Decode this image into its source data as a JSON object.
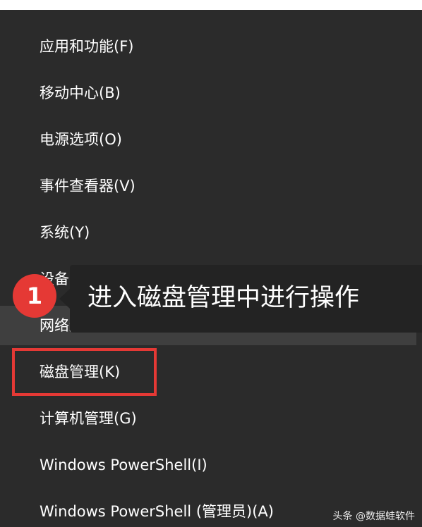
{
  "menu": {
    "items": [
      {
        "label": "应用和功能(F)"
      },
      {
        "label": "移动中心(B)"
      },
      {
        "label": "电源选项(O)"
      },
      {
        "label": "事件查看器(V)"
      },
      {
        "label": "系统(Y)"
      },
      {
        "label": "设备管理器(M)"
      },
      {
        "label": "网络连接(W)"
      },
      {
        "label": "磁盘管理(K)"
      },
      {
        "label": "计算机管理(G)"
      },
      {
        "label": "Windows PowerShell(I)"
      },
      {
        "label": "Windows PowerShell (管理员)(A)"
      }
    ]
  },
  "annotation": {
    "step_number": "1",
    "text": "进入磁盘管理中进行操作"
  },
  "watermark": {
    "text": "头条 @数据蛙软件"
  },
  "colors": {
    "menu_background": "#2b2b2b",
    "highlight": "#e53935",
    "callout_background": "#232323"
  }
}
